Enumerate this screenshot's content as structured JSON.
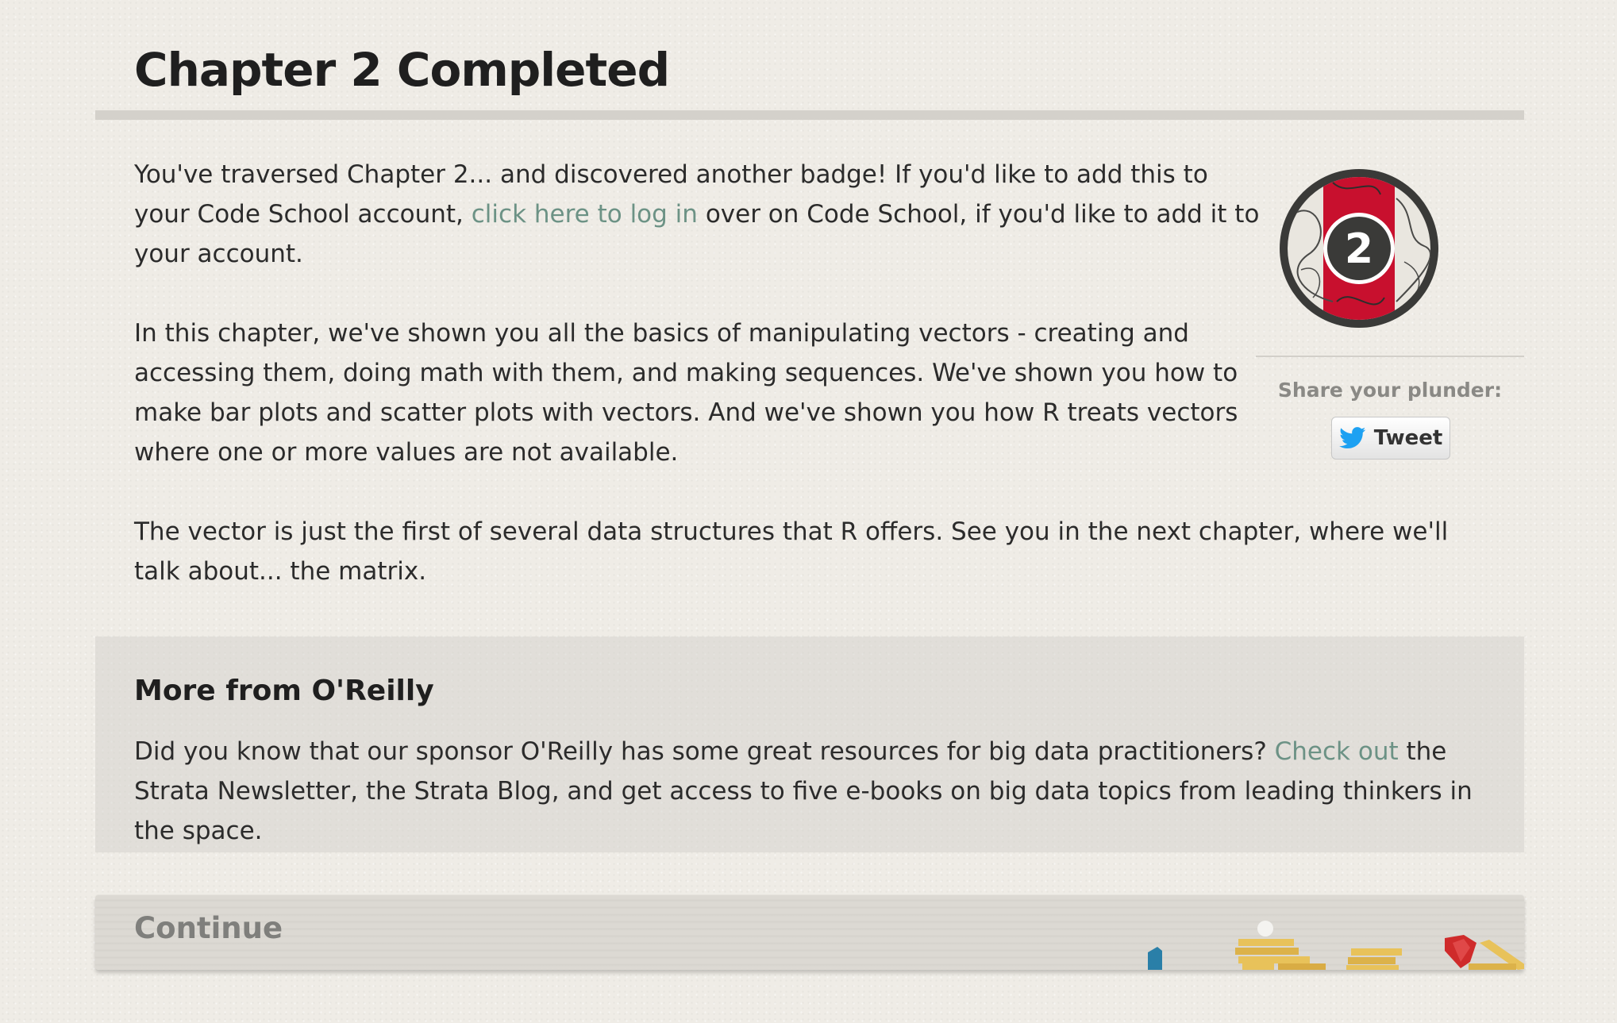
{
  "header": {
    "title": "Chapter 2 Completed"
  },
  "content": {
    "p1_before": "You've traversed Chapter 2... and discovered another badge! If you'd like to add this to your Code School account,",
    "p1_link": "click here to log in",
    "p1_after": "over on Code School, if you'd like to add it to your account.",
    "p2": "In this chapter, we've shown you all the basics of manipulating vectors - creating and accessing them, doing math with them, and making sequences. We've shown you how to make bar plots and scatter plots with vectors. And we've shown you how R treats vectors where one or more values are not available.",
    "p3": "The vector is just the first of several data structures that R offers. See you in the next chapter, where we'll talk about... the matrix."
  },
  "sidebar": {
    "badge_number": "2",
    "share_label": "Share your plunder:",
    "tweet_label": "Tweet"
  },
  "promo": {
    "heading": "More from O'Reilly",
    "text_before": "Did you know that our sponsor O'Reilly has some great resources for big data practitioners?",
    "link": "Check out",
    "text_after": "the Strata Newsletter, the Strata Blog, and get access to five e-books on big data topics from leading thinkers in the space."
  },
  "footer": {
    "continue_label": "Continue"
  },
  "colors": {
    "link": "#6c9285",
    "badge_red": "#c8102e",
    "badge_ring": "#3a3a38",
    "twitter_blue": "#1da1f2"
  },
  "icons": {
    "badge": "chapter-badge-icon",
    "tweet": "twitter-bird-icon",
    "treasure": "treasure-pile-icon"
  }
}
